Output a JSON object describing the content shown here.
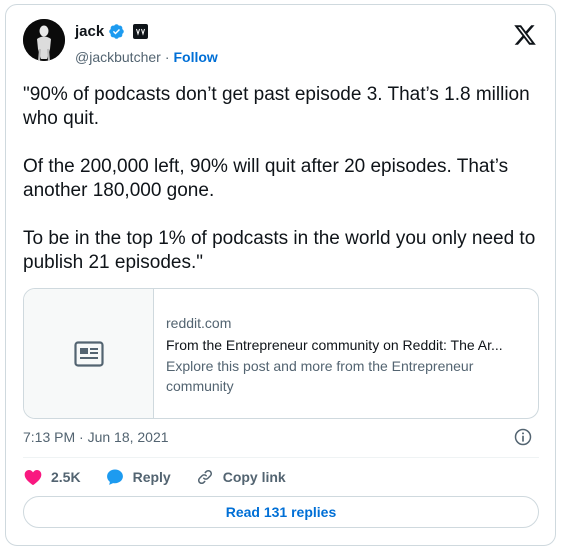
{
  "author": {
    "name": "jack",
    "handle": "@jackbutcher",
    "follow_label": "Follow",
    "separator": "·",
    "avatar_icon": "avatar-image",
    "verified_color": "#1d9bf0",
    "affiliate_badge_text": "VV"
  },
  "tweet": {
    "text": "\"90% of podcasts don’t get past episode 3. That’s 1.8 million who quit.\n\nOf the 200,000 left, 90% will quit after 20 episodes. That’s another 180,000 gone.\n\nTo be in the top 1% of podcasts in the world you only need to publish 21 episodes.\""
  },
  "link_card": {
    "domain": "reddit.com",
    "title": "From the Entrepreneur community on Reddit: The Ar...",
    "description": "Explore this post and more from the Entrepreneur community",
    "thumb_icon": "article-icon"
  },
  "meta": {
    "timestamp": "7:13 PM · Jun 18, 2021"
  },
  "actions": {
    "like_count": "2.5K",
    "reply_label": "Reply",
    "copy_label": "Copy link",
    "like_color": "#f91880",
    "reply_color": "#1d9bf0"
  },
  "footer": {
    "read_replies_label": "Read 131 replies"
  }
}
